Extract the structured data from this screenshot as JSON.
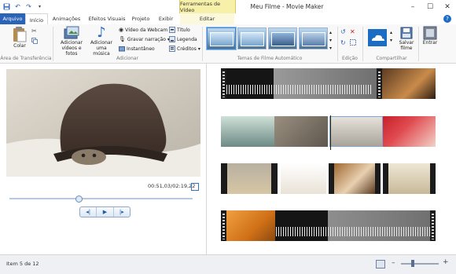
{
  "window": {
    "title": "Meu Filme - Movie Maker",
    "contextual_group": "Ferramentas de Vídeo"
  },
  "tabs": [
    {
      "label": "Arquivo"
    },
    {
      "label": "Início"
    },
    {
      "label": "Animações"
    },
    {
      "label": "Efeitos Visuais"
    },
    {
      "label": "Projeto"
    },
    {
      "label": "Exibir"
    },
    {
      "label": "Editar"
    }
  ],
  "ribbon": {
    "clipboard": {
      "paste_label": "Colar",
      "group_label": "Área de Transferência"
    },
    "add": {
      "add_videos_label": "Adicionar vídeos e fotos",
      "add_music_label": "Adicionar uma música",
      "webcam_label": "Vídeo da Webcam",
      "narration_label": "Gravar narração",
      "snapshot_label": "Instantâneo",
      "title_label": "Título",
      "caption_label": "Legenda",
      "credits_label": "Créditos",
      "group_label": "Adicionar"
    },
    "themes": {
      "group_label": "Temas de Filme Automático",
      "selected_index": 0
    },
    "editing": {
      "group_label": "Edição"
    },
    "share": {
      "save_label": "Salvar filme",
      "group_label": "Compartilhar"
    },
    "signin": {
      "label": "Entrar"
    }
  },
  "preview": {
    "timecode": "00:51,03/02:19,22",
    "seek_fraction": 0.38
  },
  "status": {
    "item_text": "Item 5 de 12"
  },
  "colors": {
    "file_tab": "#2a63b7",
    "accent": "#1d6cc4",
    "contextual_tab": "#f7f0a8"
  }
}
